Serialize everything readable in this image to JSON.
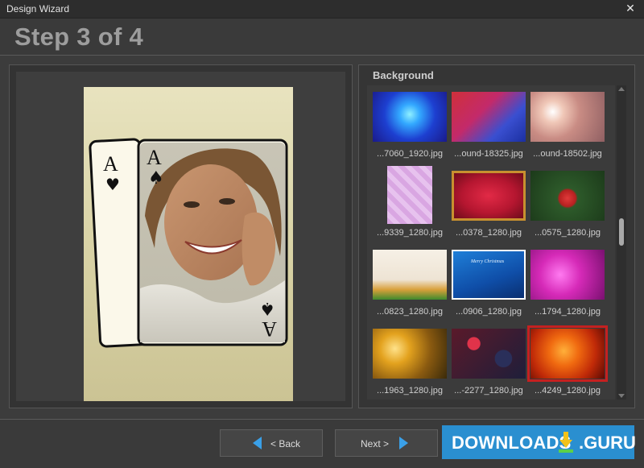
{
  "window": {
    "title": "Design Wizard",
    "close_symbol": "✕"
  },
  "header": {
    "step_title": "Step 3 of 4"
  },
  "preview": {
    "card_rank": "A",
    "card_suit": "♠",
    "card_suit_back": "♥"
  },
  "background_panel": {
    "label": "Background",
    "scroll_position": 0.46,
    "thumbnails": [
      {
        "caption": "...7060_1920.jpg",
        "style": "blue-stars",
        "selected": false
      },
      {
        "caption": "...ound-18325.jpg",
        "style": "red-flag-stars",
        "selected": false
      },
      {
        "caption": "...ound-18502.jpg",
        "style": "bokeh-pink",
        "selected": false
      },
      {
        "caption": "...9339_1280.jpg",
        "style": "pink-butterflies",
        "selected": false
      },
      {
        "caption": "...0378_1280.jpg",
        "style": "red-card",
        "selected": false
      },
      {
        "caption": "...0575_1280.jpg",
        "style": "christmas-ornament",
        "selected": false
      },
      {
        "caption": "...0823_1280.jpg",
        "style": "tulips",
        "selected": false
      },
      {
        "caption": "...0906_1280.jpg",
        "style": "merry-christmas-blue",
        "selected": false,
        "overlay_text": "Merry Christmas"
      },
      {
        "caption": "...1794_1280.jpg",
        "style": "magenta-glitter",
        "selected": false
      },
      {
        "caption": "...1963_1280.jpg",
        "style": "gold-balls",
        "selected": false
      },
      {
        "caption": "...-2277_1280.jpg",
        "style": "berries",
        "selected": false
      },
      {
        "caption": "...4249_1280.jpg",
        "style": "orange-bokeh",
        "selected": true
      }
    ]
  },
  "footer": {
    "back_label": "< Back",
    "next_label": "Next >",
    "arrow_color": "#3aa0e8"
  },
  "watermark": {
    "left_text": "DOWNLOADS",
    "right_text": ".GURU",
    "bg_color": "#2a8fd0"
  }
}
